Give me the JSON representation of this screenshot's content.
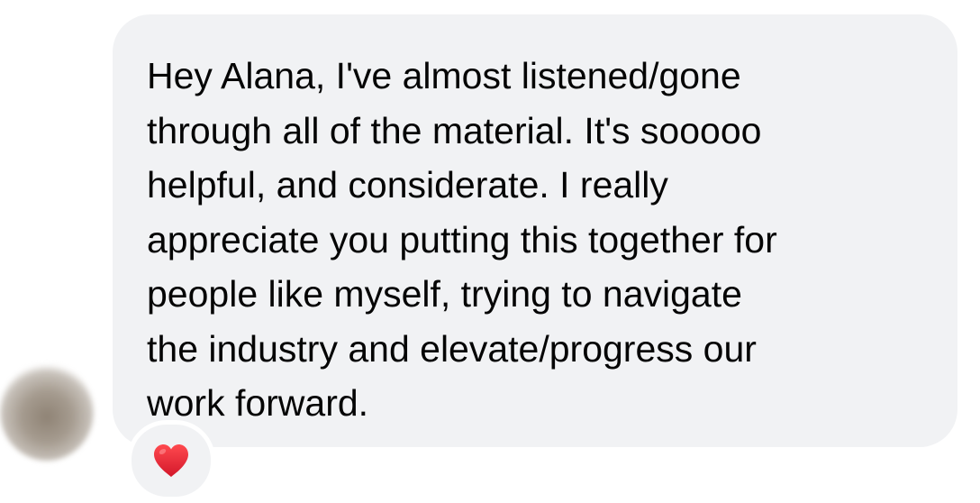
{
  "message": {
    "lines": [
      "Hey Alana, I've almost listened/gone",
      "through all of the material. It's sooooo",
      "helpful, and considerate. I really",
      "appreciate you putting this together for",
      "people like myself, trying to navigate",
      "the industry and elevate/progress our",
      "work forward."
    ],
    "bubble_color": "#f1f2f4",
    "text_color": "#050505"
  },
  "reaction": {
    "icon": "red-heart-icon",
    "color": "#e0202e"
  },
  "avatar": {
    "icon": "blurred-profile-avatar"
  }
}
